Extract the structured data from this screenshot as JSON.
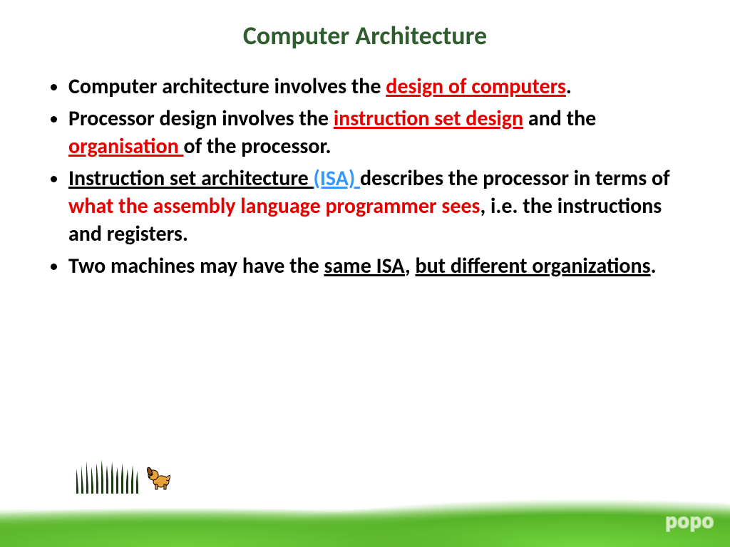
{
  "title": "Computer Architecture",
  "bullet1": {
    "a": "Computer architecture involves the ",
    "b": "design of computers",
    "c": "."
  },
  "bullet2": {
    "a": "Processor design involves the ",
    "b": "instruction set design",
    "c": " and the ",
    "d": "organisation ",
    "e": "of the processor."
  },
  "bullet3": {
    "a": "Instruction set architecture ",
    "b": "(ISA) ",
    "c": "describes the processor in terms of ",
    "d": "what the assembly language programmer sees",
    "e": ", i.e. the instructions and registers."
  },
  "bullet4": {
    "a": "Two machines may have the ",
    "b": "same ISA",
    "c": ", ",
    "d": "but different organizations",
    "e": "."
  },
  "watermark": "popo"
}
